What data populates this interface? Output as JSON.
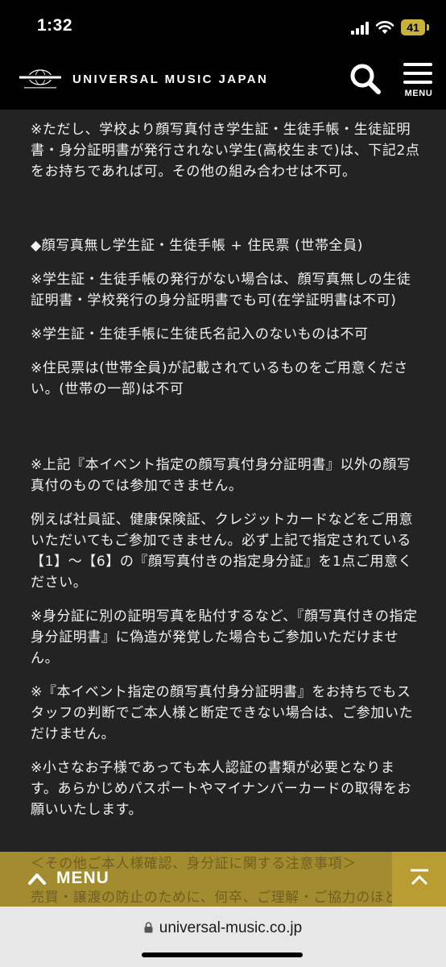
{
  "status_bar": {
    "time": "1:32",
    "battery": "41"
  },
  "header": {
    "brand": "UNIVERSAL MUSIC JAPAN",
    "menu_label": "MENU"
  },
  "content": {
    "paragraphs": [
      "※ただし、学校より顔写真付き学生証・生徒手帳・生徒証明書・身分証明書が発行されない学生(高校生まで)は、下記2点をお持ちであれば可。その他の組み合わせは不可。",
      "◆顔写真無し学生証・生徒手帳 + 住民票 (世帯全員)",
      "※学生証・生徒手帳の発行がない場合は、顔写真無しの生徒証明書・学校発行の身分証明書でも可(在学証明書は不可)",
      "※学生証・生徒手帳に生徒氏名記入のないものは不可",
      "※住民票は(世帯全員)が記載されているものをご用意ください。(世帯の一部)は不可",
      "※上記『本イベント指定の顔写真付身分証明書』以外の顔写真付のものでは参加できません。",
      "例えば社員証、健康保険証、クレジットカードなどをご用意いただいてもご参加できません。必ず上記で指定されている【1】～【6】の『顔写真付きの指定身分証』を1点ご用意ください。",
      "※身分証に別の証明写真を貼付するなど、『顔写真付きの指定身分証明書』に偽造が発覚した場合もご参加いただけません。",
      "※『本イベント指定の顔写真付身分証明書』をお持ちでもスタッフの判断でご本人様と断定できない場合は、ご参加いただけません。",
      "※小さなお子様であっても本人認証の書類が必要となります。あらかじめパスポートやマイナンバーカードの取得をお願いいたします。"
    ]
  },
  "bottom": {
    "section_heading": "＜その他ご本人様確認、身分証に関する注意事項＞",
    "section_line": "売買・譲渡の防止のために、何卒、ご理解・ご協力のほど",
    "menu_label": "MENU"
  },
  "browser": {
    "url": "universal-music.co.jp"
  },
  "colors": {
    "page_bg": "#232323",
    "header_bg": "#000000",
    "bottom_bar": "#a38c2f",
    "battery": "#c8b23a"
  }
}
